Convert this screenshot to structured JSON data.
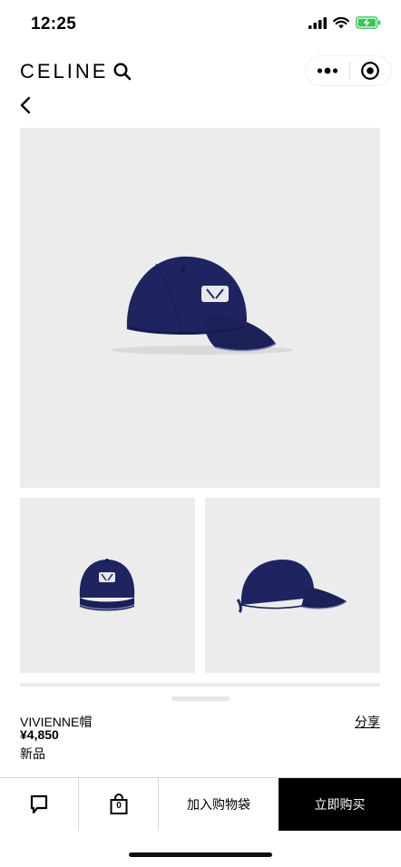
{
  "status_bar": {
    "time": "12:25",
    "icons": [
      "signal-icon",
      "wifi-icon",
      "battery-charging-icon"
    ],
    "battery_color": "#34c759"
  },
  "header": {
    "brand": "CELINE",
    "search_icon": "search-icon",
    "menu_icon": "more-dots-icon",
    "close_icon": "target-close-icon"
  },
  "nav": {
    "back_icon": "chevron-left-icon"
  },
  "gallery": {
    "background": "#ececec",
    "cap_color": "#1e2460",
    "images": [
      "cap-side-three-quarter",
      "cap-front",
      "cap-profile"
    ]
  },
  "product": {
    "name": "VIVIENNE帽",
    "price": "¥4,850",
    "tag": "新品",
    "share_label": "分享"
  },
  "bottom_bar": {
    "chat_icon": "chat-bubble-icon",
    "bag_icon": "shopping-bag-icon",
    "bag_count": "0",
    "add_to_bag_label": "加入购物袋",
    "buy_now_label": "立即购买"
  }
}
